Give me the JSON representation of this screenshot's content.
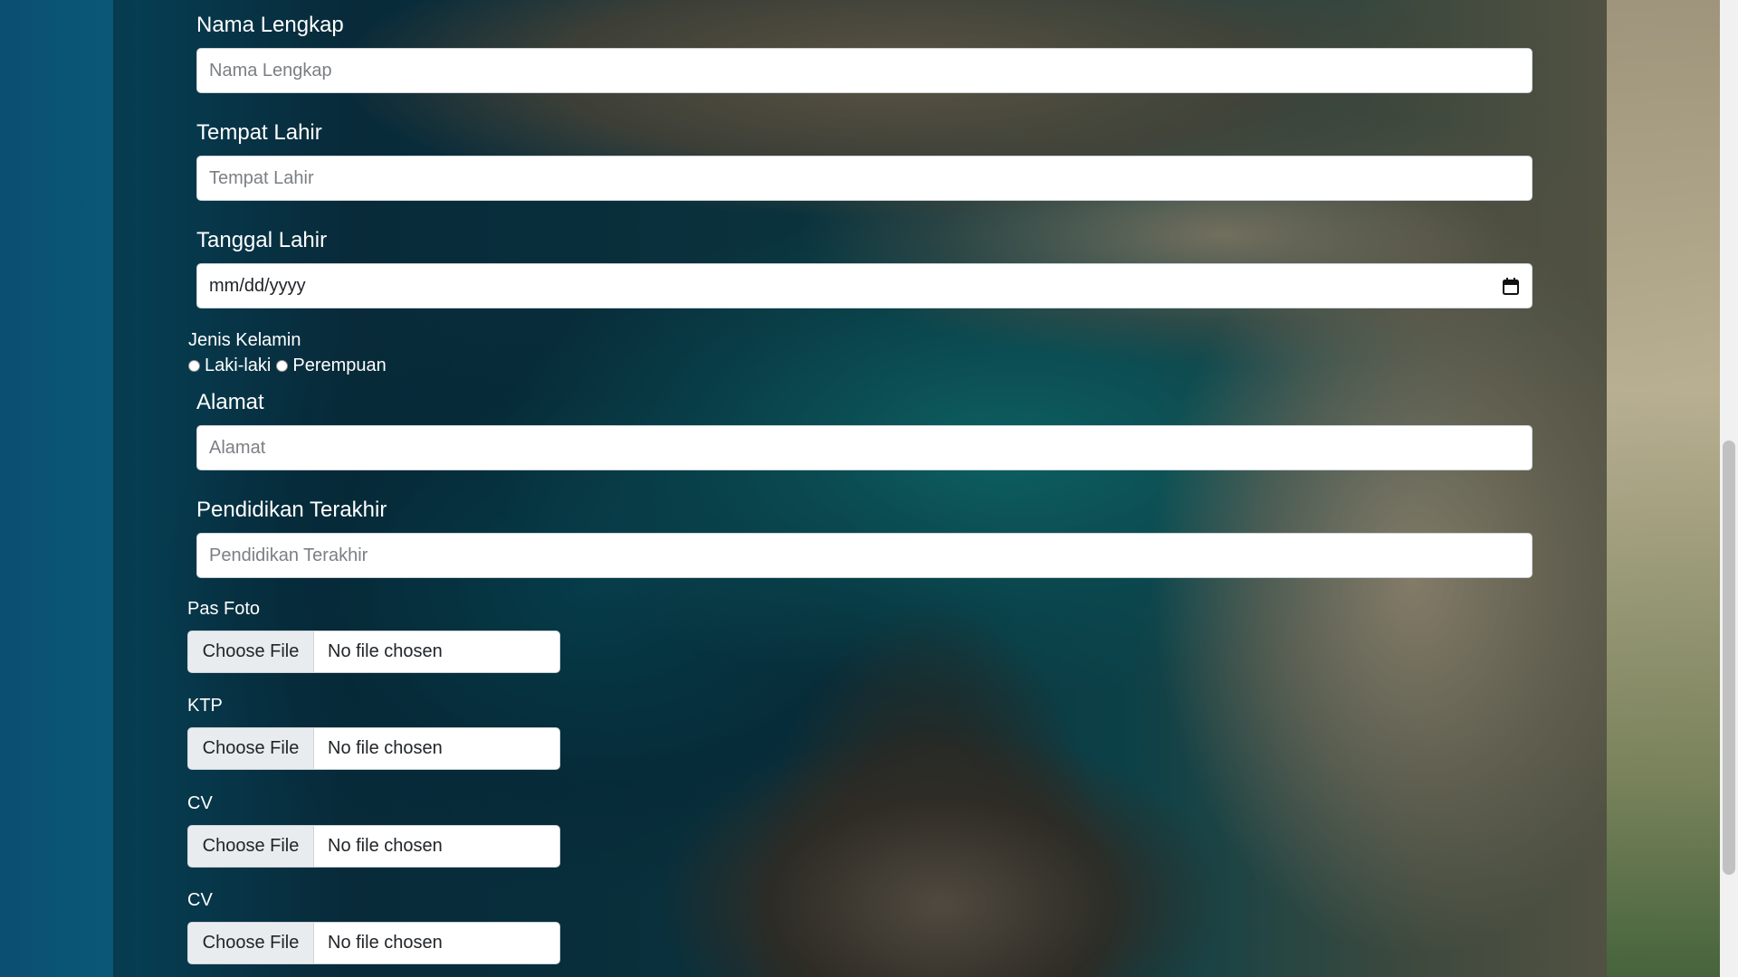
{
  "form": {
    "nama_lengkap": {
      "label": "Nama Lengkap",
      "placeholder": "Nama Lengkap",
      "value": ""
    },
    "tempat_lahir": {
      "label": "Tempat Lahir",
      "placeholder": "Tempat Lahir",
      "value": ""
    },
    "tanggal_lahir": {
      "label": "Tanggal Lahir",
      "placeholder": "mm/dd/yyyy",
      "icon": "calendar-icon"
    },
    "jenis_kelamin": {
      "label": "Jenis Kelamin",
      "options": [
        {
          "label": "Laki-laki",
          "checked": false
        },
        {
          "label": "Perempuan",
          "checked": false
        }
      ]
    },
    "alamat": {
      "label": "Alamat",
      "placeholder": "Alamat",
      "value": ""
    },
    "pendidikan_terakhir": {
      "label": "Pendidikan Terakhir",
      "placeholder": "Pendidikan Terakhir",
      "value": ""
    },
    "files": [
      {
        "label": "Pas Foto",
        "button": "Choose File",
        "status": "No file chosen"
      },
      {
        "label": "KTP",
        "button": "Choose File",
        "status": "No file chosen"
      },
      {
        "label": "CV",
        "button": "Choose File",
        "status": "No file chosen"
      },
      {
        "label": "CV",
        "button": "Choose File",
        "status": "No file chosen"
      }
    ]
  },
  "colors": {
    "label_text": "#ffffff",
    "input_background": "#ffffff",
    "file_button_background": "#e9ecef",
    "scrollbar_thumb": "#c1c1c1"
  }
}
